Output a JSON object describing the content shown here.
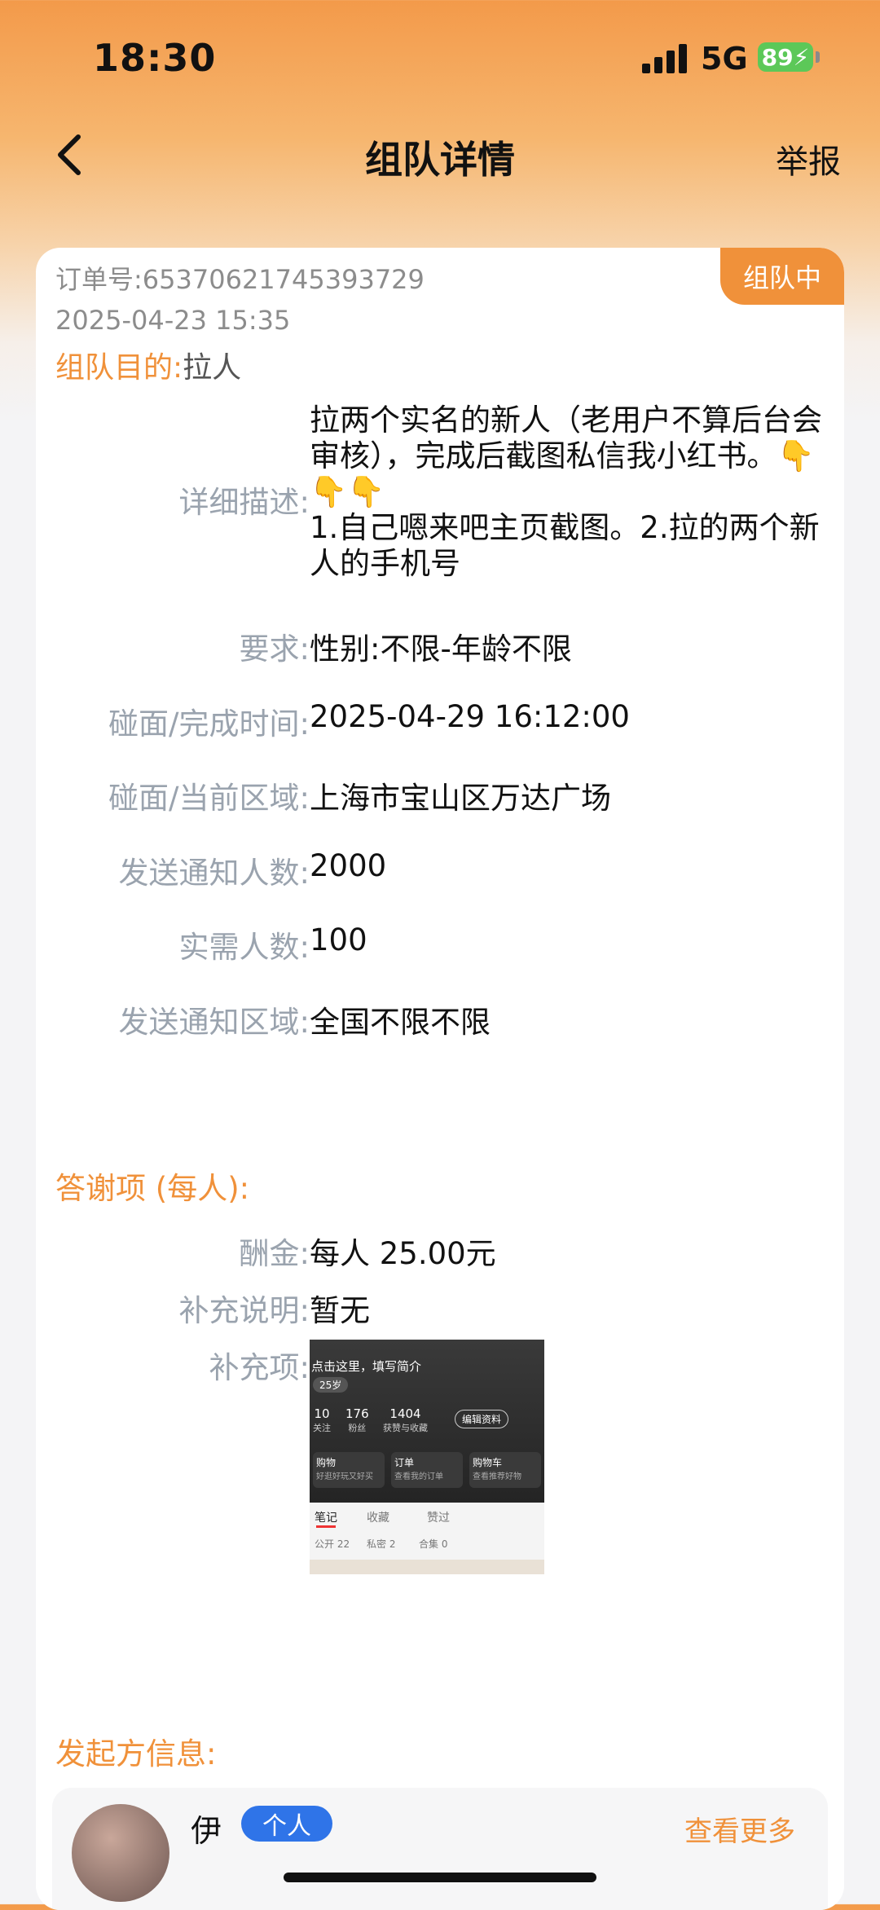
{
  "status_bar": {
    "time": "18:30",
    "network": "5G",
    "battery": "89"
  },
  "nav": {
    "title": "组队详情",
    "report": "举报"
  },
  "order": {
    "status_badge": "组队中",
    "order_no": "订单号:65370621745393729",
    "created_at": "2025-04-23 15:35",
    "purpose_label": "组队目的:",
    "purpose_value": "拉人"
  },
  "details": {
    "description_label": "详细描述:",
    "description": "拉两个实名的新人（老用户不算后台会审核），完成后截图私信我小红书。👇👇👇\n1.自己嗯来吧主页截图。2.拉的两个新人的手机号",
    "requirement_label": "要求:",
    "requirement": "性别:不限-年龄不限",
    "time_label": "碰面/完成时间:",
    "time": "2025-04-29 16:12:00",
    "area_label": "碰面/当前区域:",
    "area": "上海市宝山区万达广场",
    "notify_count_label": "发送通知人数:",
    "notify_count": "2000",
    "needed_label": "实需人数:",
    "needed": "100",
    "notify_area_label": "发送通知区域:",
    "notify_area": "全国不限不限"
  },
  "reward": {
    "section_title": "答谢项 (每人):",
    "pay_label": "酬金:",
    "pay": "每人 25.00元",
    "note_label": "补充说明:",
    "note": "暂无",
    "extra_label": "补充项:"
  },
  "thumbnail": {
    "intro": "点击这里，填写简介",
    "age": "25岁",
    "stats": [
      {
        "num": "10",
        "label": "关注"
      },
      {
        "num": "176",
        "label": "粉丝"
      },
      {
        "num": "1404",
        "label": "获赞与收藏"
      }
    ],
    "edit": "编辑资料",
    "menus": [
      {
        "title": "购物",
        "sub": "好逛好玩又好买"
      },
      {
        "title": "订单",
        "sub": "查看我的订单"
      },
      {
        "title": "购物车",
        "sub": "查看推荐好物"
      }
    ],
    "tabs": [
      "笔记",
      "收藏",
      "赞过"
    ],
    "filters": [
      "公开 22",
      "私密 2",
      "合集 0"
    ]
  },
  "initiator": {
    "section_title": "发起方信息:",
    "name": "伊",
    "tag": "个人",
    "more": "查看更多"
  }
}
